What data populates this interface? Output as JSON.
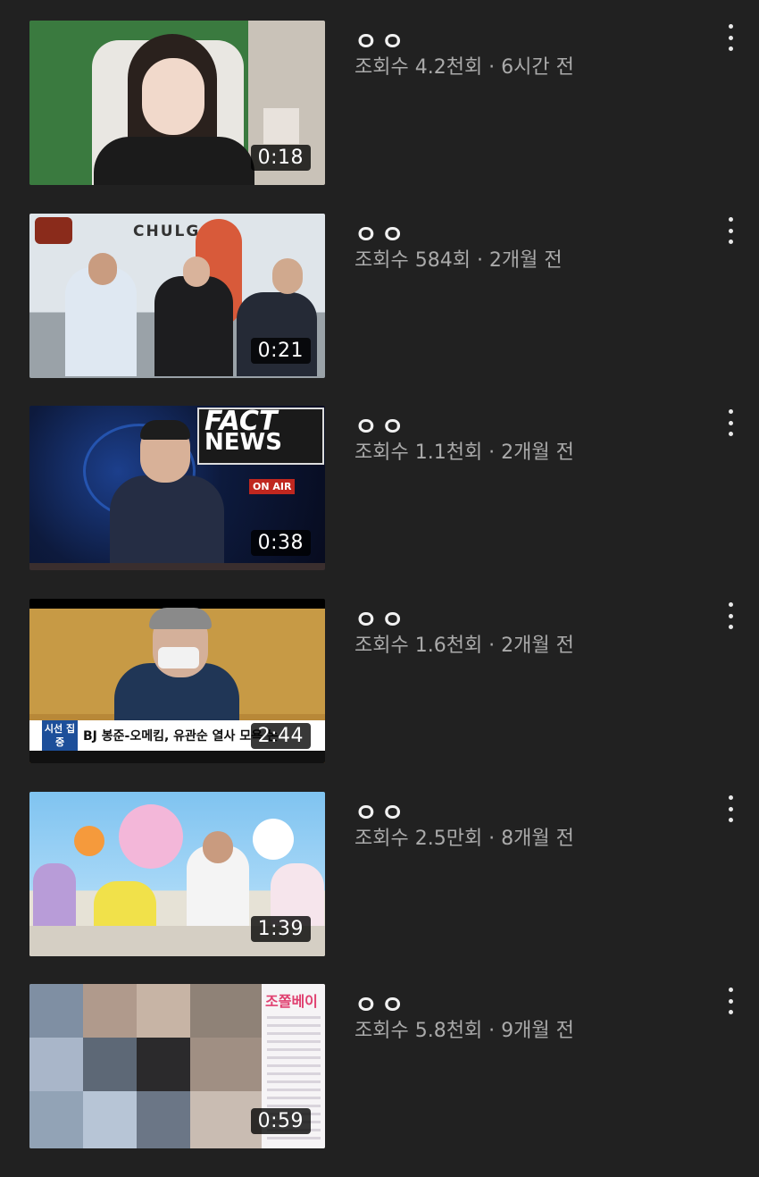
{
  "videos": [
    {
      "title": "ㅇㅇ",
      "meta": "조회수 4.2천회 · 6시간 전",
      "duration": "0:18"
    },
    {
      "title": "ㅇㅇ",
      "meta": "조회수 584회 · 2개월 전",
      "duration": "0:21"
    },
    {
      "title": "ㅇㅇ",
      "meta": "조회수 1.1천회 · 2개월 전",
      "duration": "0:38"
    },
    {
      "title": "ㅇㅇ",
      "meta": "조회수 1.6천회 · 2개월 전",
      "duration": "2:44"
    },
    {
      "title": "ㅇㅇ",
      "meta": "조회수 2.5만회 · 8개월 전",
      "duration": "1:39"
    },
    {
      "title": "ㅇㅇ",
      "meta": "조회수 5.8천회 · 9개월 전",
      "duration": "0:59"
    }
  ],
  "thumb_text": {
    "chulg": "CHULG",
    "fact": "FACT",
    "news": "NEWS",
    "on_air": "ON AIR",
    "caption_tag": "시선 집중",
    "caption": "BJ 봉준-오메킴, 유관순 열사 모욕 논",
    "jjobbei": "조쫄베이"
  },
  "colors": {
    "background": "#212121",
    "meta": "#aaaaaa",
    "title": "#f1f1f1"
  },
  "icons": {
    "more": "vertical-ellipsis-icon"
  }
}
